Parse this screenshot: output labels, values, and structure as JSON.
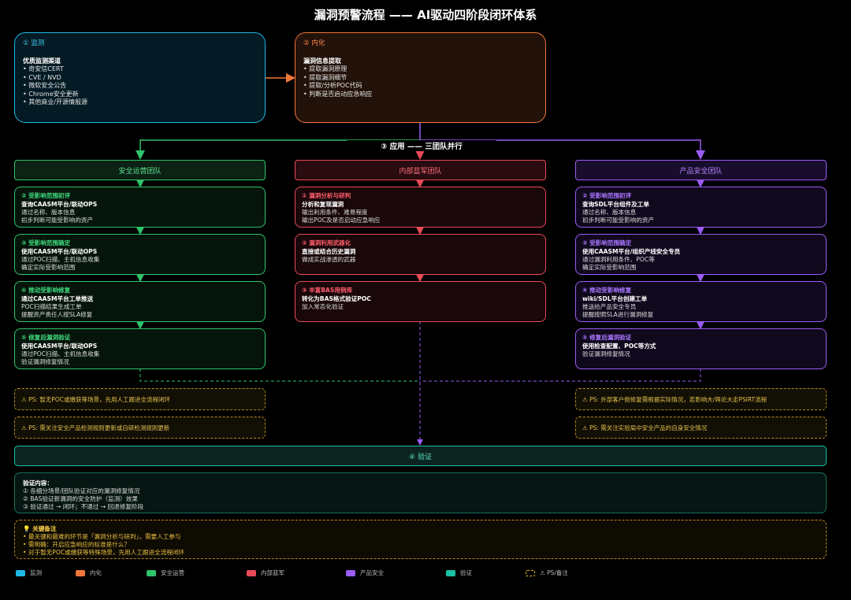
{
  "title": "漏洞预警流程 —— AI驱动四阶段闭环体系",
  "colors": {
    "cyan": "#1fb8e6",
    "orange": "#f0773a",
    "green": "#2fc36b",
    "red": "#e84a57",
    "purple": "#9a5cf5",
    "teal": "#19c2a4",
    "yellow": "#e0b020"
  },
  "monitor": {
    "heading": "① 监测",
    "subtitle": "优质监测渠道",
    "items": [
      "• 奇安信CERT",
      "• CVE / NVD",
      "• 微软安全公告",
      "• Chrome安全更新",
      "• 其他商业/开源情报源"
    ]
  },
  "internalize": {
    "heading": "② 内化",
    "subtitle": "漏洞信息提取",
    "items": [
      "• 提取漏洞原理",
      "• 提取漏洞细节",
      "• 提取/分析POC代码",
      "• 判断是否启动应急响应"
    ]
  },
  "apply_label": "③ 应用 —— 三团队并行",
  "teams": [
    {
      "name": "安全运营团队",
      "cards": [
        {
          "title": "② 受影响范围初评",
          "sub": "查询CAASM平台/联动OPS",
          "lines": [
            "通过名称、版本信息",
            "初步判断可能受影响的资产"
          ]
        },
        {
          "title": "③ 受影响范围确定",
          "sub": "使用CAASM平台/联动OPS",
          "lines": [
            "通过POC扫描、主机信息收集",
            "确定实际受影响范围"
          ]
        },
        {
          "title": "④ 推动受影响修复",
          "sub": "通过CAASM平台工单推送",
          "lines": [
            "POC扫描结果生成工单",
            "提醒资产责任人按SLA修复"
          ]
        },
        {
          "title": "⑤ 修复后漏洞验证",
          "sub": "使用CAASM平台/联动OPS",
          "lines": [
            "通过POC扫描、主机信息收集",
            "验证漏洞修复情况"
          ]
        }
      ]
    },
    {
      "name": "内部蓝军团队",
      "cards": [
        {
          "title": "① 漏洞分析与研判",
          "sub": "分析和复现漏洞",
          "lines": [
            "输出利用条件、难易程度",
            "输出POC及是否启动应急响应"
          ]
        },
        {
          "title": "② 漏洞利用武器化",
          "sub": "直接或结合历史漏洞",
          "lines": [
            "做成实战渗透的武器"
          ]
        },
        {
          "title": "③ 丰富BAS用例库",
          "sub": "转化为BAS格式验证POC",
          "lines": [
            "加入常态化验证"
          ]
        }
      ]
    },
    {
      "name": "产品安全团队",
      "cards": [
        {
          "title": "② 受影响范围初评",
          "sub": "查询SDL平台组件及工单",
          "lines": [
            "通过名称、版本信息",
            "初步判断可能受影响的资产"
          ]
        },
        {
          "title": "③ 受影响范围确定",
          "sub": "使用CAASM平台/组织产线安全专员",
          "lines": [
            "通过漏洞利用条件、POC等",
            "确定实际受影响范围"
          ]
        },
        {
          "title": "④ 推动受影响修复",
          "sub": "wiki/SDL平台创建工单",
          "lines": [
            "推送给产品安全专员",
            "提醒按照SLA进行漏洞修复"
          ]
        },
        {
          "title": "⑤ 修复后漏洞验证",
          "sub": "使用检查配置、POC等方式",
          "lines": [
            "验证漏洞修复情况"
          ]
        }
      ]
    }
  ],
  "notes": {
    "left": [
      "⚠ PS: 暂无POC或缴获等场景，先用人工跟进全流程闭环",
      "⚠ PS: 需关注安全产品检测规则更新或自研检测规则更新"
    ],
    "right": [
      "⚠ PS: 外部客户侧修复需根据实际情况，若影响大/舆论大走PSIRT流程",
      "⚠ PS: 需关注实验局中安全产品的自身安全情况"
    ]
  },
  "verify": {
    "heading": "④ 验证",
    "subtitle": "验证内容：",
    "items": [
      "① 各细分场景/团队验证对应的漏洞修复情况",
      "② BAS验证新漏洞的安全防护（监测）效果",
      "③ 验证通过 → 闭环；不通过 → 回退修复阶段"
    ]
  },
  "key_notes": {
    "heading": "💡 关键备注",
    "items": [
      "• 最关键和最难的环节是「漏洞分析与研判」，需要人工参与",
      "• 需明确：开启应急响应的标准是什么？",
      "• 对于暂无POC或缴获等特殊场景，先用人工跟进全流程闭环"
    ]
  },
  "legend": [
    {
      "label": "监测",
      "color": "#1fb8e6",
      "style": "solid"
    },
    {
      "label": "内化",
      "color": "#f0773a",
      "style": "solid"
    },
    {
      "label": "安全运营",
      "color": "#2fc36b",
      "style": "solid"
    },
    {
      "label": "内部蓝军",
      "color": "#e84a57",
      "style": "solid"
    },
    {
      "label": "产品安全",
      "color": "#9a5cf5",
      "style": "solid"
    },
    {
      "label": "验证",
      "color": "#19c2a4",
      "style": "solid"
    },
    {
      "label": "⚠ PS/备注",
      "color": "#e0b020",
      "style": "dashed"
    }
  ]
}
